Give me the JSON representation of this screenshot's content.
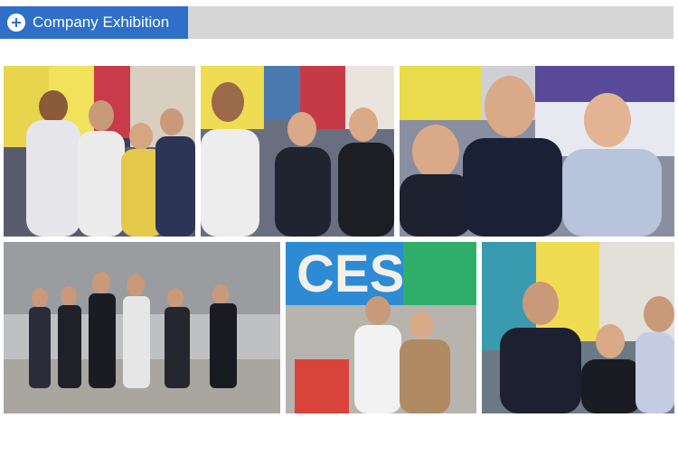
{
  "section": {
    "title": "Company Exhibition",
    "icon": "plus-circle-icon",
    "accent_color": "#2f6fc8",
    "bar_color": "#d6d6d6"
  },
  "gallery": {
    "photos": [
      {
        "label": "exhibition-photo-1"
      },
      {
        "label": "exhibition-photo-2"
      },
      {
        "label": "exhibition-photo-3"
      },
      {
        "label": "exhibition-photo-4"
      },
      {
        "label": "exhibition-photo-5",
        "sign_text": "CES"
      },
      {
        "label": "exhibition-photo-6"
      }
    ]
  }
}
